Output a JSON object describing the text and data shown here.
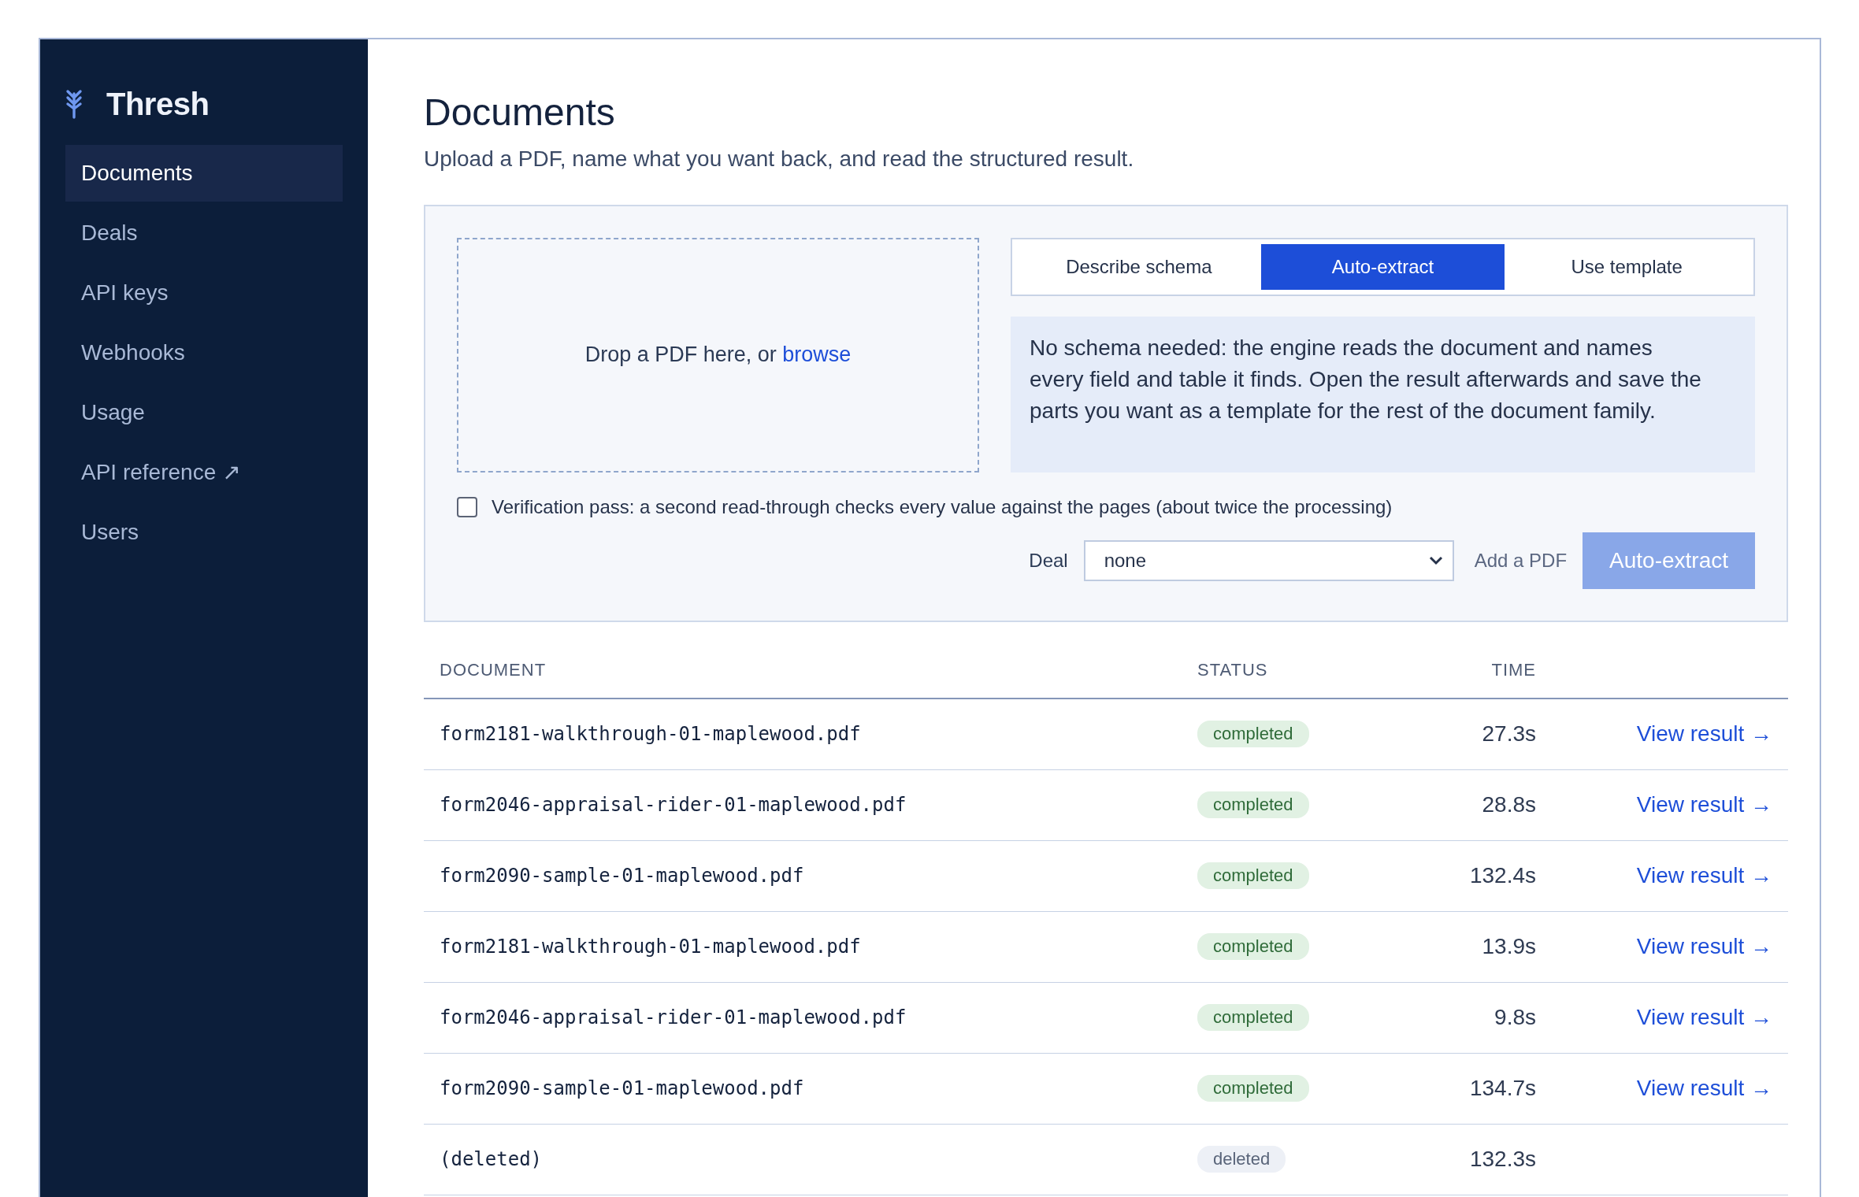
{
  "sidebar": {
    "brand": "Thresh",
    "items": [
      {
        "label": "Documents",
        "selected": true
      },
      {
        "label": "Deals",
        "selected": false
      },
      {
        "label": "API keys",
        "selected": false
      },
      {
        "label": "Webhooks",
        "selected": false
      },
      {
        "label": "Usage",
        "selected": false
      },
      {
        "label": "API reference ↗",
        "selected": false
      },
      {
        "label": "Users",
        "selected": false
      }
    ]
  },
  "page": {
    "title": "Documents",
    "subtitle": "Upload a PDF, name what you want back, and read the structured result."
  },
  "upload": {
    "dropzone": {
      "text": "Drop a PDF here, or",
      "link": "browse"
    },
    "tabs": [
      {
        "label": "Describe schema",
        "selected": false
      },
      {
        "label": "Auto-extract",
        "selected": true
      },
      {
        "label": "Use template",
        "selected": false
      }
    ],
    "info": "No schema needed: the engine reads the document and names every field and table it finds. Open the result afterwards and save the parts you want as a template for the rest of the document family.",
    "verification": {
      "label": "Verification pass: a second read-through checks every value against the pages (about twice the processing)",
      "checked": false
    },
    "deal": {
      "label": "Deal",
      "value": "none"
    },
    "hint": "Add a PDF",
    "submit": {
      "label": "Auto-extract",
      "disabled": true
    }
  },
  "table": {
    "columns": [
      "DOCUMENT",
      "STATUS",
      "TIME"
    ],
    "rows": [
      {
        "kind": "active",
        "document": "form2181-walkthrough-01-maplewood.pdf",
        "status": "completed",
        "time": "27.3s",
        "action": "View result →"
      },
      {
        "kind": "active",
        "document": "form2046-appraisal-rider-01-maplewood.pdf",
        "status": "completed",
        "time": "28.8s",
        "action": "View result →"
      },
      {
        "kind": "active",
        "document": "form2090-sample-01-maplewood.pdf",
        "status": "completed",
        "time": "132.4s",
        "action": "View result →"
      },
      {
        "kind": "active",
        "document": "form2181-walkthrough-01-maplewood.pdf",
        "status": "completed",
        "time": "13.9s",
        "action": "View result →"
      },
      {
        "kind": "active",
        "document": "form2046-appraisal-rider-01-maplewood.pdf",
        "status": "completed",
        "time": "9.8s",
        "action": "View result →"
      },
      {
        "kind": "active",
        "document": "form2090-sample-01-maplewood.pdf",
        "status": "completed",
        "time": "134.7s",
        "action": "View result →"
      },
      {
        "kind": "deleted",
        "document": "(deleted)",
        "status": "deleted",
        "time": "132.3s"
      }
    ]
  }
}
